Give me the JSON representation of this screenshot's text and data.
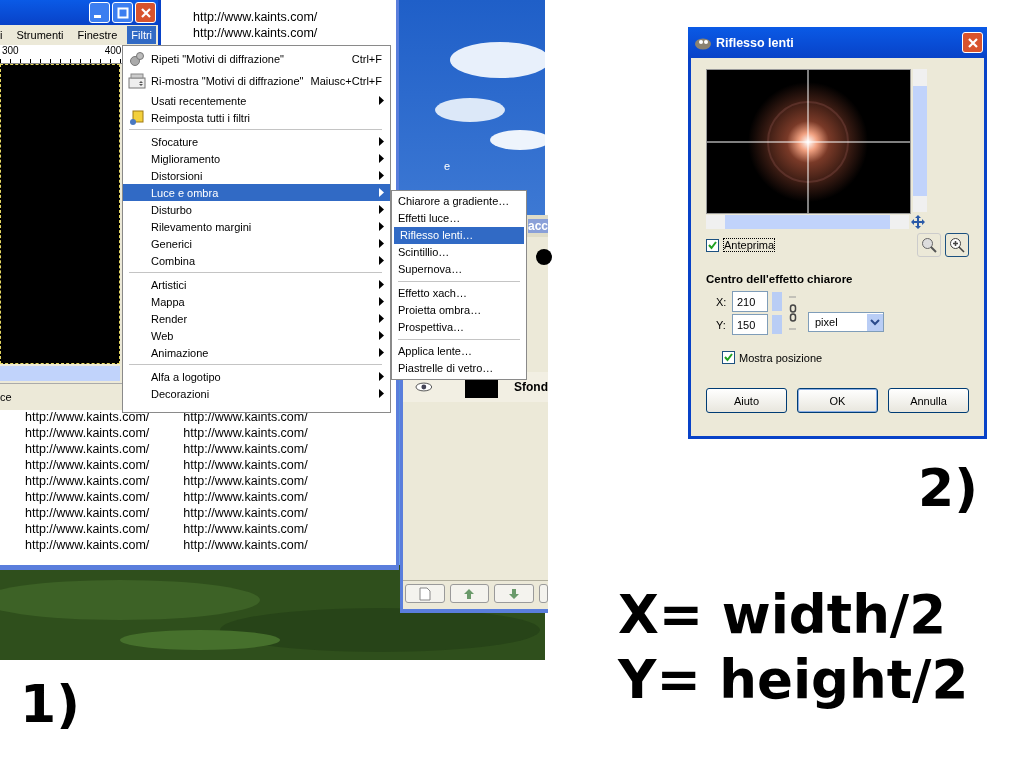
{
  "image_window": {
    "menubar": [
      {
        "label": "i",
        "selected": false
      },
      {
        "label": "Strumenti",
        "selected": false
      },
      {
        "label": "Finestre",
        "selected": false
      },
      {
        "label": "Filtri",
        "selected": true
      }
    ],
    "ruler_marks": [
      "300",
      "400"
    ],
    "status_text": "ce"
  },
  "document": {
    "top_lines": [
      "http://www.kaints.com/",
      "http://www.kaints.com/"
    ],
    "columns": [
      [
        "http://www.kaints.com/",
        "http://www.kaints.com/",
        "http://www.kaints.com/",
        "http://www.kaints.com/",
        "http://www.kaints.com/",
        "http://www.kaints.com/",
        "http://www.kaints.com/",
        "http://www.kaints.com/",
        "http://www.kaints.com/"
      ],
      [
        "http://www.kaints.com/",
        "http://www.kaints.com/",
        "http://www.kaints.com/",
        "http://www.kaints.com/",
        "http://www.kaints.com/",
        "http://www.kaints.com/",
        "http://www.kaints.com/",
        "http://www.kaints.com/",
        "http://www.kaints.com/"
      ]
    ]
  },
  "desktop_label": "e",
  "filters_menu": {
    "items": [
      {
        "kind": "gear",
        "label": "Ripeti \"Motivi di diffrazione\"",
        "shortcut": "Ctrl+F",
        "submenu": false,
        "selected": false
      },
      {
        "kind": "counter",
        "label": "Ri-mostra \"Motivi di diffrazione\"",
        "shortcut": "Maiusc+Ctrl+F",
        "submenu": false,
        "selected": false
      },
      {
        "kind": "item",
        "label": "Usati recentemente",
        "submenu": true,
        "selected": false
      },
      {
        "kind": "reset",
        "label": "Reimposta tutti i filtri",
        "submenu": false,
        "selected": false
      },
      {
        "kind": "separator"
      },
      {
        "kind": "item",
        "label": "Sfocature",
        "submenu": true,
        "selected": false
      },
      {
        "kind": "item",
        "label": "Miglioramento",
        "submenu": true,
        "selected": false
      },
      {
        "kind": "item",
        "label": "Distorsioni",
        "submenu": true,
        "selected": false
      },
      {
        "kind": "item",
        "label": "Luce e ombra",
        "submenu": true,
        "selected": true
      },
      {
        "kind": "item",
        "label": "Disturbo",
        "submenu": true,
        "selected": false
      },
      {
        "kind": "item",
        "label": "Rilevamento margini",
        "submenu": true,
        "selected": false
      },
      {
        "kind": "item",
        "label": "Generici",
        "submenu": true,
        "selected": false
      },
      {
        "kind": "item",
        "label": "Combina",
        "submenu": true,
        "selected": false
      },
      {
        "kind": "separator"
      },
      {
        "kind": "item",
        "label": "Artistici",
        "submenu": true,
        "selected": false
      },
      {
        "kind": "item",
        "label": "Mappa",
        "submenu": true,
        "selected": false
      },
      {
        "kind": "item",
        "label": "Render",
        "submenu": true,
        "selected": false
      },
      {
        "kind": "item",
        "label": "Web",
        "submenu": true,
        "selected": false
      },
      {
        "kind": "item",
        "label": "Animazione",
        "submenu": true,
        "selected": false
      },
      {
        "kind": "separator"
      },
      {
        "kind": "item",
        "label": "Alfa a logotipo",
        "submenu": true,
        "selected": false
      },
      {
        "kind": "item",
        "label": "Decorazioni",
        "submenu": true,
        "selected": false
      }
    ]
  },
  "submenu": {
    "items": [
      {
        "kind": "item",
        "label": "Chiarore a gradiente…",
        "selected": false
      },
      {
        "kind": "item",
        "label": "Effetti luce…",
        "selected": false
      },
      {
        "kind": "item",
        "label": "Riflesso lenti…",
        "selected": true
      },
      {
        "kind": "item",
        "label": "Scintillio…",
        "selected": false
      },
      {
        "kind": "item",
        "label": "Supernova…",
        "selected": false
      },
      {
        "kind": "separator"
      },
      {
        "kind": "item",
        "label": "Effetto xach…",
        "selected": false
      },
      {
        "kind": "item",
        "label": "Proietta ombra…",
        "selected": false
      },
      {
        "kind": "item",
        "label": "Prospettiva…",
        "selected": false
      },
      {
        "kind": "separator"
      },
      {
        "kind": "item",
        "label": "Applica lente…",
        "selected": false
      },
      {
        "kind": "item",
        "label": "Piastrelle di vetro…",
        "selected": false
      }
    ]
  },
  "layers_panel": {
    "title": "acc",
    "layer_name": "Sfond"
  },
  "dialog": {
    "title": "Riflesso lenti",
    "preview_checkbox": {
      "label": "Anteprima",
      "checked": true
    },
    "section_title": "Centro dell'effetto chiarore",
    "x_label": "X:",
    "x_value": "210",
    "y_label": "Y:",
    "y_value": "150",
    "unit": "pixel",
    "show_position": {
      "label": "Mostra posizione",
      "checked": true
    },
    "buttons": [
      "Aiuto",
      "OK",
      "Annulla"
    ]
  },
  "captions": {
    "left": "1)",
    "right": "2)",
    "lines": [
      "X= width/2",
      "Y= height/2"
    ]
  }
}
